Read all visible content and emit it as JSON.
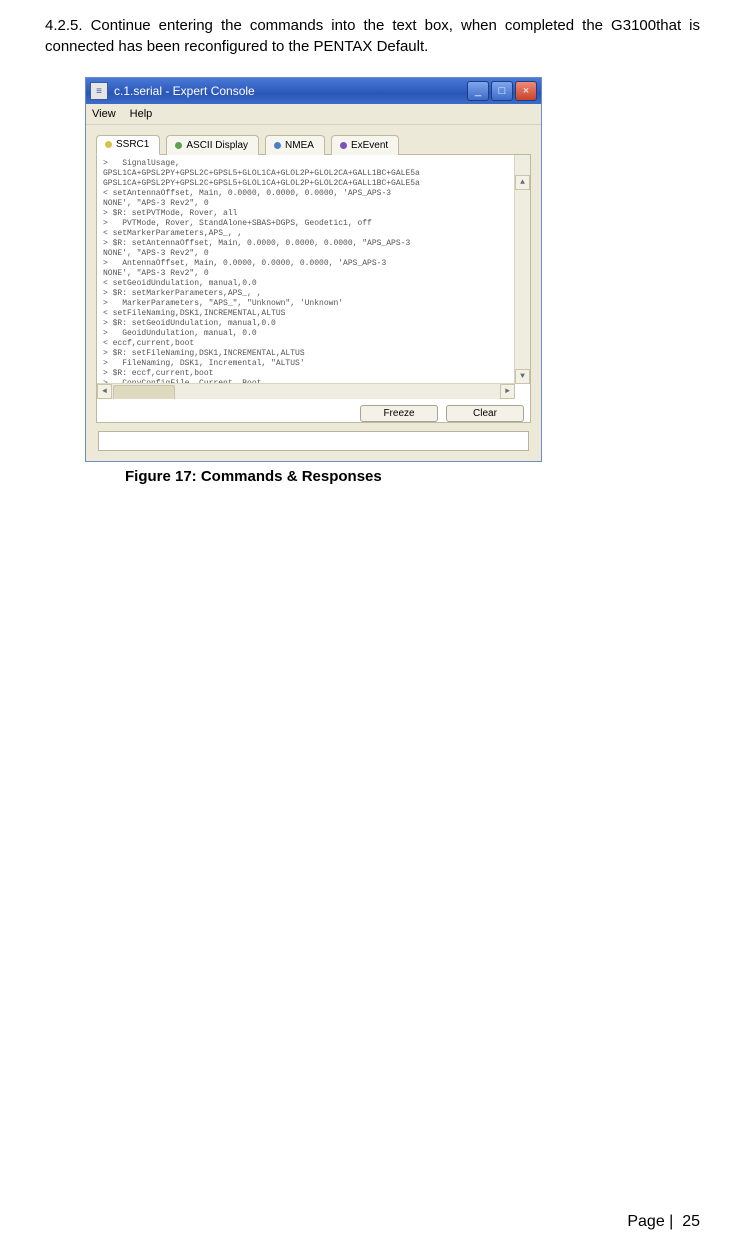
{
  "section": {
    "number": "4.2.5.",
    "text": "Continue entering the commands into the text box, when completed the G3100that is connected has been reconfigured to the PENTAX Default."
  },
  "window": {
    "title": "c.1.serial - Expert Console",
    "icon_label": "≡",
    "minimize": "_",
    "maximize": "□",
    "close": "×",
    "menu": {
      "view": "View",
      "help": "Help"
    },
    "tabs": [
      {
        "label": "SSRC1",
        "color": "#d6c24a",
        "active": true
      },
      {
        "label": "ASCII Display",
        "color": "#5aa34f",
        "active": false
      },
      {
        "label": "NMEA",
        "color": "#4b7fc8",
        "active": false
      },
      {
        "label": "ExEvent",
        "color": "#7a55b8",
        "active": false
      }
    ],
    "console_lines": [
      ">   SignalUsage,",
      "GPSL1CA+GPSL2PY+GPSL2C+GPSL5+GLOL1CA+GLOL2P+GLOL2CA+GALL1BC+GALE5a",
      "GPSL1CA+GPSL2PY+GPSL2C+GPSL5+GLOL1CA+GLOL2P+GLOL2CA+GALL1BC+GALE5a",
      "< setAntennaOffset, Main, 0.0000, 0.0000, 0.0000, 'APS_APS-3",
      "NONE', \"APS-3 Rev2\", 0",
      "> $R: setPVTMode, Rover, all",
      ">   PVTMode, Rover, StandAlone+SBAS+DGPS, Geodetic1, off",
      "< setMarkerParameters,APS_, ,",
      "> $R: setAntennaOffset, Main, 0.0000, 0.0000, 0.0000, \"APS_APS-3",
      "NONE', \"APS-3 Rev2\", 0",
      ">   AntennaOffset, Main, 0.0000, 0.0000, 0.0000, 'APS_APS-3",
      "NONE', \"APS-3 Rev2\", 0",
      "< setGeoidUndulation, manual,0.0",
      "> $R: setMarkerParameters,APS_, ,",
      ">   MarkerParameters, \"APS_\", \"Unknown\", 'Unknown'",
      "< setFileNaming,DSK1,INCREMENTAL,ALTUS",
      "> $R: setGeoidUndulation, manual,0.0",
      ">   GeoidUndulation, manual, 0.0",
      "< eccf,current,boot",
      "> $R: setFileNaming,DSK1,INCREMENTAL,ALTUS",
      ">   FileNaming, DSK1, Incremental, \"ALTUS'",
      "> $R: eccf,current,boot",
      ">   CopyConfigFile, Current, Boot"
    ],
    "buttons": {
      "freeze": "Freeze",
      "clear": "Clear"
    }
  },
  "caption": "Figure 17: Commands & Responses",
  "footer": {
    "label": "Page  |",
    "num": "25"
  }
}
